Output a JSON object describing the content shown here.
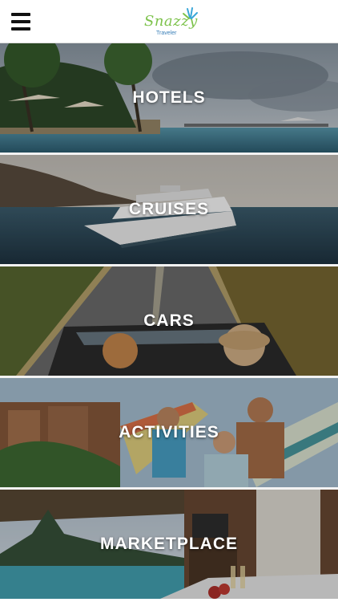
{
  "header": {
    "logo_text": "Snazzy",
    "logo_subtext": "Traveler"
  },
  "tiles": [
    {
      "label": "HOTELS",
      "icon": "resort-photo"
    },
    {
      "label": "CRUISES",
      "icon": "cruise-ship-photo"
    },
    {
      "label": "CARS",
      "icon": "convertible-car-photo"
    },
    {
      "label": "ACTIVITIES",
      "icon": "surfing-family-photo"
    },
    {
      "label": "MARKETPLACE",
      "icon": "tropical-island-photo"
    }
  ]
}
